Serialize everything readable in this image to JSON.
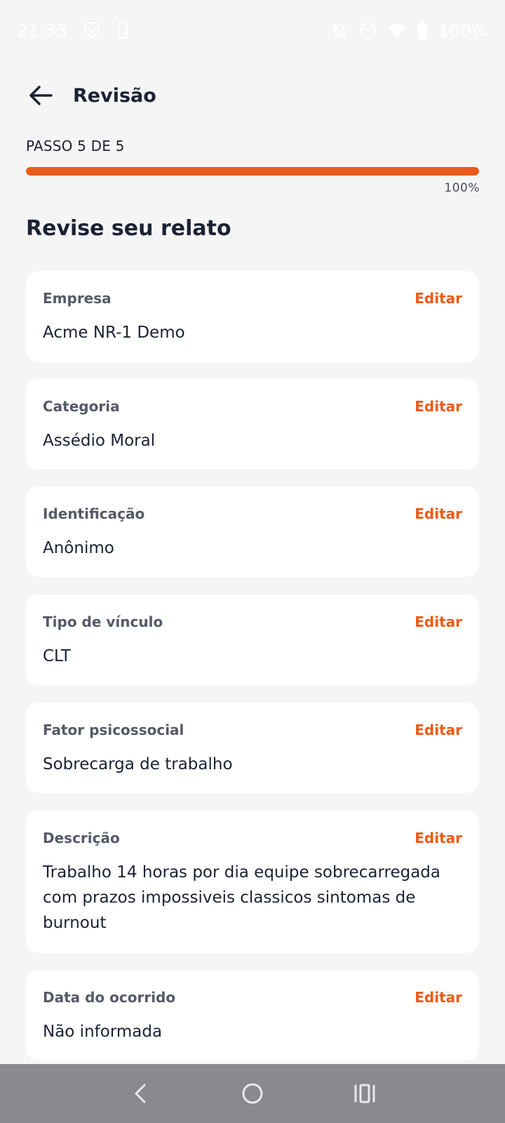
{
  "status_bar": {
    "time": "21:33",
    "battery": "100%",
    "icons": [
      "vpn-shield-icon",
      "phone-icon",
      "vibrate-off-icon",
      "do-not-disturb-icon",
      "wifi-icon",
      "battery-icon"
    ]
  },
  "app_bar": {
    "back_icon": "arrow-left-icon",
    "title": "Revisão"
  },
  "progress": {
    "step_label": "PASSO 5 DE 5",
    "percent_label": "100%",
    "value": 1.0
  },
  "section_title": "Revise seu relato",
  "cards": [
    {
      "label": "Empresa",
      "value": "Acme NR-1 Demo",
      "edit": "Editar"
    },
    {
      "label": "Categoria",
      "value": "Assédio Moral",
      "edit": "Editar"
    },
    {
      "label": "Identificação",
      "value": "Anônimo",
      "edit": "Editar"
    },
    {
      "label": "Tipo de vínculo",
      "value": "CLT",
      "edit": "Editar"
    },
    {
      "label": "Fator psicossocial",
      "value": "Sobrecarga de trabalho",
      "edit": "Editar"
    },
    {
      "label": "Descrição",
      "value": "Trabalho 14 horas por dia equipe sobrecarregada com prazos impossiveis classicos sintomas de burnout",
      "edit": "Editar"
    },
    {
      "label": "Data do ocorrido",
      "value": "Não informada",
      "edit": "Editar"
    }
  ],
  "colors": {
    "accent": "#ec5a16",
    "background": "#f6f5f6",
    "card": "#ffffff",
    "text": "#1b2234",
    "nav_bar": "#898a8f"
  },
  "nav_bar": {
    "icons": [
      "nav-back-icon",
      "nav-home-icon",
      "nav-recents-icon"
    ]
  }
}
